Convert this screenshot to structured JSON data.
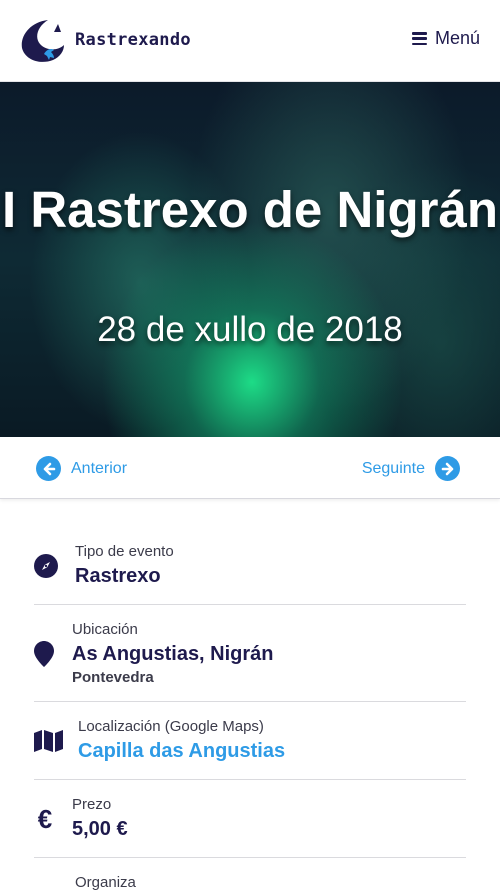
{
  "header": {
    "brand": "Rastrexando",
    "menu_label": "Menú"
  },
  "hero": {
    "title": "I Rastrexo de Nigrán",
    "date": "28 de xullo de 2018"
  },
  "nav": {
    "prev_label": "Anterior",
    "next_label": "Seguinte"
  },
  "details": {
    "event_type": {
      "label": "Tipo de evento",
      "value": "Rastrexo",
      "icon": "compass-icon"
    },
    "location": {
      "label": "Ubicación",
      "value": "As Angustias, Nigrán",
      "sub": "Pontevedra",
      "icon": "map-pin-icon"
    },
    "maps": {
      "label": "Localización (Google Maps)",
      "value": "Capilla das Angustias",
      "icon": "map-icon"
    },
    "price": {
      "label": "Prezo",
      "value": "5,00 €",
      "icon": "euro-icon"
    },
    "organizer": {
      "label": "Organiza"
    }
  },
  "colors": {
    "navy": "#1e1a4d",
    "accent_blue": "#2e9be6",
    "hero_glow": "#1ee68c"
  }
}
